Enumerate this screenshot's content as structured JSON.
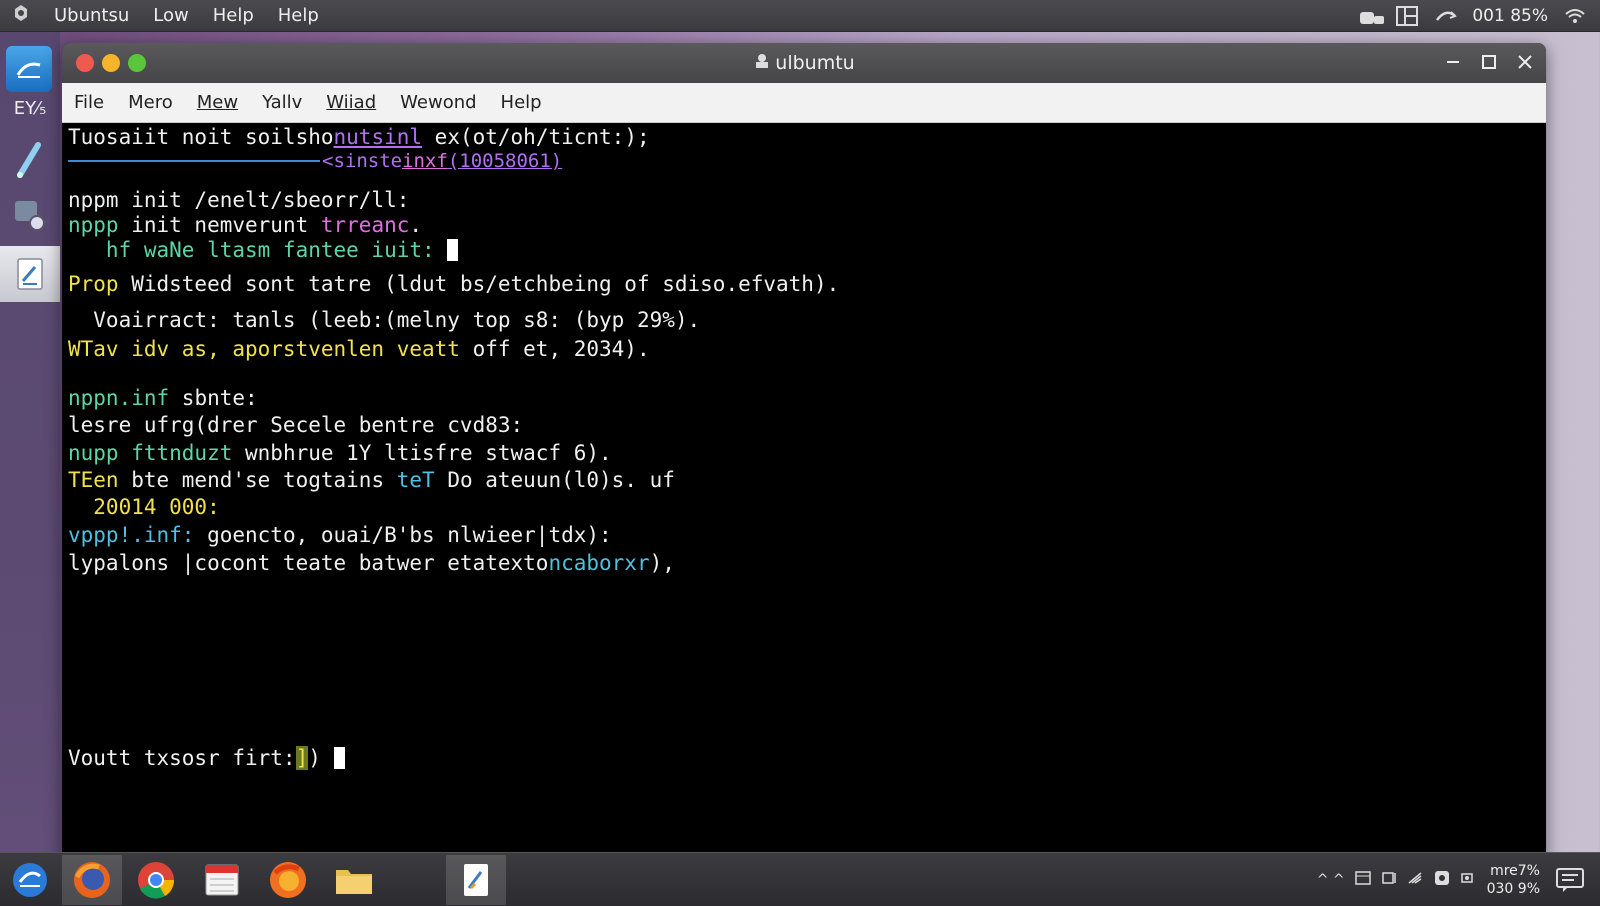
{
  "topbar": {
    "menus": [
      "Ubuntsu",
      "Low",
      "Help",
      "Help"
    ],
    "status_text": "001 85%"
  },
  "dock": {
    "label": "EY⁄₅"
  },
  "window": {
    "title": "ulbumtu",
    "menu": [
      "File",
      "Mero",
      "Mew",
      "Yallv",
      "Wiiad",
      "Wewond",
      "Help"
    ]
  },
  "terminal": {
    "lines": [
      "Tuosaiit noit soilsho",
      "nutsinl",
      " ex(ot/oh/ticnt:);",
      "<sinste",
      "inxf",
      "(10058061)",
      "nppm init /enelt/sbeorr/ll:",
      "nppp",
      " init nemverunt ",
      "trreanc",
      ".",
      "   hf waNe ltasm fantee iuit: ",
      "Prop",
      " Widsteed sont tatre (ldut bs/etchbeing of sdiso.efvath).",
      "  Voairract: tanls (leeb:(melny top s8: (byp 29%).",
      "WTav idv as, aporstvenlen veatt",
      " off et, 2034).",
      "nppn.inf",
      " sbnte:",
      "lesre ufrg(drer Secele bentre cvd83:",
      "nupp fttnduzt",
      " wnbhrue 1Y ltisfre stwacf 6).",
      "TEen",
      " bte mend'se togtains ",
      "teT",
      " Do ateuun(l0)s. uf",
      "  20014 000:",
      "vppp!.inf:",
      " goencto, ouai/B'bs nlwieer|tdx):",
      "lypalons |cocont teate batwer etatexto",
      "ncaborxr",
      "),",
      "Voutt txsosr firt:",
      "]",
      ") "
    ]
  },
  "taskbar": {
    "tray_text": "^ ^",
    "clock_line1": "mre7%",
    "clock_line2": "030 9%"
  },
  "colors": {
    "terminal_bg": "#000000",
    "yellow": "#f2e24a",
    "green": "#5cd6a8",
    "pink": "#e070e0",
    "cyan": "#4ec0e0"
  }
}
